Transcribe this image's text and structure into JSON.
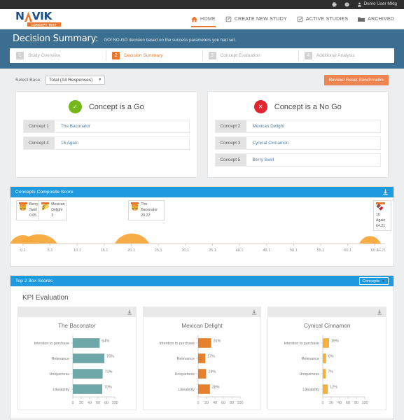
{
  "topbar": {
    "items": [
      {
        "icon": "printer-icon",
        "label": ""
      },
      {
        "icon": "help-icon",
        "label": ""
      },
      {
        "icon": "user-icon",
        "label": "Demo User Mktg"
      }
    ],
    "user_label": "Demo User Mktg"
  },
  "brand": {
    "name_part1": "N",
    "name_part2": "VIK",
    "tagline": "CONCEPT TEST"
  },
  "nav": {
    "items": [
      {
        "label": "HOME",
        "icon": "home-icon",
        "active": true
      },
      {
        "label": "CREATE NEW STUDY",
        "icon": "pencil-note-icon",
        "active": false
      },
      {
        "label": "ACTIVE STUDIES",
        "icon": "checklist-icon",
        "active": false
      },
      {
        "label": "ARCHIVED",
        "icon": "folder-icon",
        "active": false
      }
    ]
  },
  "band": {
    "title": "Decision Summary:",
    "subtitle": "GO/ NO-GO decision based on the success parameters you had set.",
    "steps": [
      {
        "num": "1",
        "label": "Study Overview",
        "active": false
      },
      {
        "num": "2",
        "label": "Decision Summary",
        "active": true
      },
      {
        "num": "3",
        "label": "Concept Evaluation",
        "active": false
      },
      {
        "num": "4",
        "label": "Additional Analysis",
        "active": false
      }
    ]
  },
  "controls": {
    "base_label": "Select Base:",
    "base_value": "Total (All Responses)",
    "benchmarks_button": "Review/ Reset Benchmarks"
  },
  "decision": {
    "go": {
      "title": "Concept is a Go",
      "badge_glyph": "✓",
      "badge_color": "#74b71b",
      "rows": [
        {
          "key": "Concept 1",
          "value": "The Baconator"
        },
        {
          "key": "Concept 4",
          "value": "16 Again"
        }
      ]
    },
    "nogo": {
      "title": "Concept is a No Go",
      "badge_glyph": "✕",
      "badge_color": "#e0252f",
      "rows": [
        {
          "key": "Concept 2",
          "value": "Mexican Delight"
        },
        {
          "key": "Concept 3",
          "value": "Cynical Cinnamon"
        },
        {
          "key": "Concept 5",
          "value": "Berry Swirl"
        }
      ]
    }
  },
  "composite_card": {
    "title": "Concepts Composite Score",
    "download_icon": "download-icon"
  },
  "top2box_card": {
    "title": "Top 2 Box Scores",
    "concepts_button": "Concepts",
    "kpi_heading": "KPI Evaluation",
    "download_icon": "download-icon"
  },
  "chart_data": [
    {
      "type": "area",
      "name": "concepts-composite-score",
      "title": "Concepts Composite Score",
      "xlabel": "",
      "ylabel": "",
      "xlim": [
        0.1,
        67.0
      ],
      "xticks": [
        "0.1",
        "5.1",
        "10.1",
        "15.1",
        "20.1",
        "25.1",
        "30.1",
        "35.1",
        "40.1",
        "45.1",
        "50.1",
        "55.1",
        "60.1",
        "65.1"
      ],
      "xtick_values": [
        0.1,
        5.1,
        10.1,
        15.1,
        20.1,
        25.1,
        30.1,
        35.1,
        40.1,
        45.1,
        50.1,
        55.1,
        60.1,
        65.1
      ],
      "grid": false,
      "legend": "none",
      "markers": [
        {
          "label": "Berry Swirl",
          "value": "0.05",
          "x": 0.05
        },
        {
          "label": "Mexican Delight",
          "value": "3",
          "x": 3
        },
        {
          "label": "The Baconator",
          "value": "20.22",
          "x": 20.22
        },
        {
          "label": "16 Again",
          "value": "64.21",
          "x": 64.21
        }
      ],
      "extra_tick": "64.21"
    },
    {
      "type": "bar",
      "name": "kpi-the-baconator",
      "title": "The Baconator",
      "orientation": "horizontal",
      "categories": [
        "Intention to purchase",
        "Relevance",
        "Uniqueness",
        "Likeability"
      ],
      "values": [
        64,
        75,
        71,
        70
      ],
      "labels": [
        "64%",
        "75%",
        "71%",
        "70%"
      ],
      "xlim": [
        0,
        100
      ],
      "xticks": [
        "0",
        "20",
        "40",
        "60",
        "80",
        "100"
      ],
      "color": "#6ea7a8"
    },
    {
      "type": "bar",
      "name": "kpi-mexican-delight",
      "title": "Mexican Delight",
      "orientation": "horizontal",
      "categories": [
        "Intention to purchase",
        "Relevance",
        "Uniqueness",
        "Likeability"
      ],
      "values": [
        31,
        17,
        19,
        28
      ],
      "labels": [
        "31%",
        "17%",
        "19%",
        "28%"
      ],
      "xlim": [
        0,
        100
      ],
      "xticks": [
        "0",
        "20",
        "40",
        "60",
        "80",
        "100"
      ],
      "color": "#e5812c"
    },
    {
      "type": "bar",
      "name": "kpi-cynical-cinnamon",
      "title": "Cynical Cinnamon",
      "orientation": "horizontal",
      "categories": [
        "Intention to purchase",
        "Relevance",
        "Uniqueness",
        "Likeability"
      ],
      "values": [
        15,
        8,
        7,
        12
      ],
      "labels": [
        "15%",
        "8%",
        "7%",
        "12%"
      ],
      "xlim": [
        0,
        100
      ],
      "xticks": [
        "0",
        "20",
        "40",
        "60",
        "80",
        "100"
      ],
      "color": "#f5b03e"
    }
  ]
}
